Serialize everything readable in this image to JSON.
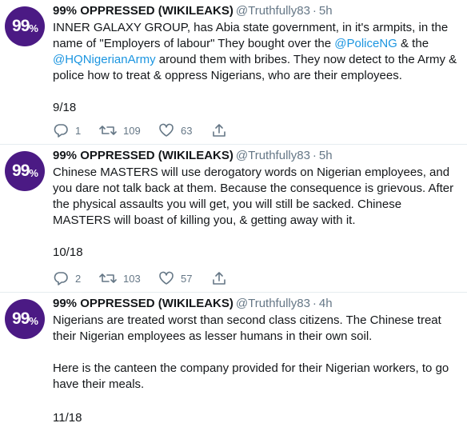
{
  "tweets": [
    {
      "avatar": "99",
      "avatar_suffix": "%",
      "name": "99% OPPRESSED (WIKILEAKS)",
      "handle": "@Truthfully83",
      "dot": "·",
      "time": "5h",
      "text_parts": [
        "INNER GALAXY GROUP, has Abia state government, in it's armpits, in the name of \"Employers of labour\" They bought over the ",
        "@PoliceNG",
        " & the ",
        "@HQNigerianArmy",
        " around them with bribes. They now detect to the Army & police how to treat & oppress Nigerians, who are their employees."
      ],
      "counter": "9/18",
      "replies": "1",
      "retweets": "109",
      "likes": "63"
    },
    {
      "avatar": "99",
      "avatar_suffix": "%",
      "name": "99% OPPRESSED (WIKILEAKS)",
      "handle": "@Truthfully83",
      "dot": "·",
      "time": "5h",
      "text": "Chinese MASTERS will use derogatory words on Nigerian employees, and you dare not talk back at them. Because the consequence is grievous. After the physical assaults you will get, you will still be sacked. Chinese MASTERS will boast of killing you, & getting away with it.",
      "counter": "10/18",
      "replies": "2",
      "retweets": "103",
      "likes": "57"
    },
    {
      "avatar": "99",
      "avatar_suffix": "%",
      "name": "99% OPPRESSED (WIKILEAKS)",
      "handle": "@Truthfully83",
      "dot": "·",
      "time": "4h",
      "text": "Nigerians are treated worst than second class citizens. The Chinese treat their Nigerian employees as lesser humans in their own soil.\n\nHere is the canteen the company provided for their Nigerian workers, to go have their meals.",
      "counter": "11/18"
    }
  ],
  "icons": {
    "reply": "reply-icon",
    "retweet": "retweet-icon",
    "like": "heart-icon",
    "share": "share-icon"
  },
  "colors": {
    "avatar_bg": "#4b1a84",
    "link": "#1b95e0",
    "muted": "#657786",
    "divider": "#e6ecf0"
  }
}
